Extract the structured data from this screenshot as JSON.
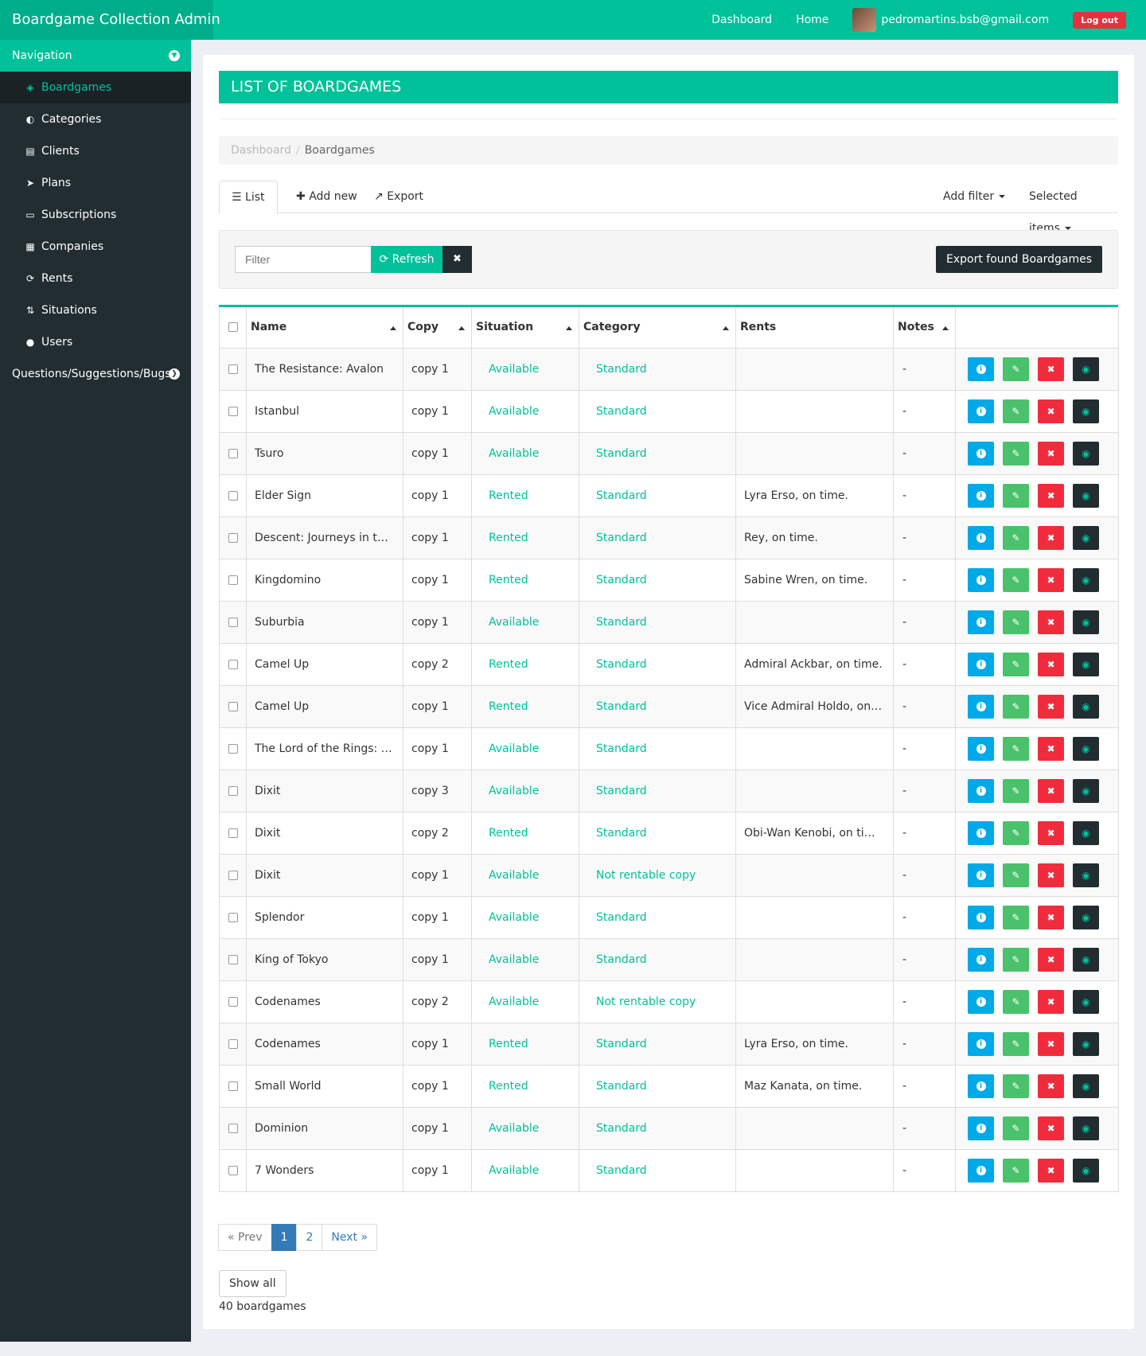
{
  "app": {
    "brand": "Boardgame Collection Admin",
    "nav_links": [
      "Dashboard",
      "Home"
    ],
    "user_email": "pedromartins.bsb@gmail.com",
    "logout_label": "Log out",
    "accent": "#00c19a"
  },
  "sidebar": {
    "header": "Navigation",
    "items": [
      {
        "label": "Boardgames",
        "icon": "cubes-icon",
        "active": true
      },
      {
        "label": "Categories",
        "icon": "adjust-icon"
      },
      {
        "label": "Clients",
        "icon": "id-card-icon"
      },
      {
        "label": "Plans",
        "icon": "tags-icon"
      },
      {
        "label": "Subscriptions",
        "icon": "credit-card-icon"
      },
      {
        "label": "Companies",
        "icon": "building-icon"
      },
      {
        "label": "Rents",
        "icon": "refresh-icon"
      },
      {
        "label": "Situations",
        "icon": "sort-numeric-icon"
      },
      {
        "label": "Users",
        "icon": "user-icon"
      }
    ],
    "extra": "Questions/Suggestions/Bugs?"
  },
  "main": {
    "title": "LIST OF BOARDGAMES",
    "breadcrumb": {
      "root": "Dashboard",
      "current": "Boardgames"
    },
    "tabs": {
      "list": "List",
      "add": "Add new",
      "export": "Export",
      "add_filter": "Add filter",
      "selected_items": "Selected items"
    },
    "filter": {
      "placeholder": "Filter",
      "refresh": "Refresh",
      "export_found": "Export found Boardgames"
    },
    "columns": [
      "Name",
      "Copy",
      "Situation",
      "Category",
      "Rents",
      "Notes"
    ],
    "rows": [
      {
        "name": "The Resistance: Avalon",
        "copy": "copy 1",
        "situation": "Available",
        "category": "Standard",
        "rents": "",
        "notes": "-"
      },
      {
        "name": "Istanbul",
        "copy": "copy 1",
        "situation": "Available",
        "category": "Standard",
        "rents": "",
        "notes": "-"
      },
      {
        "name": "Tsuro",
        "copy": "copy 1",
        "situation": "Available",
        "category": "Standard",
        "rents": "",
        "notes": "-"
      },
      {
        "name": "Elder Sign",
        "copy": "copy 1",
        "situation": "Rented",
        "category": "Standard",
        "rents": "Lyra Erso, on time.",
        "notes": "-"
      },
      {
        "name": "Descent: Journeys in the ...",
        "copy": "copy 1",
        "situation": "Rented",
        "category": "Standard",
        "rents": "Rey, on time.",
        "notes": "-"
      },
      {
        "name": "Kingdomino",
        "copy": "copy 1",
        "situation": "Rented",
        "category": "Standard",
        "rents": "Sabine Wren, on time.",
        "notes": "-"
      },
      {
        "name": "Suburbia",
        "copy": "copy 1",
        "situation": "Available",
        "category": "Standard",
        "rents": "",
        "notes": "-"
      },
      {
        "name": "Camel Up",
        "copy": "copy 2",
        "situation": "Rented",
        "category": "Standard",
        "rents": "Admiral Ackbar, on time.",
        "notes": "-"
      },
      {
        "name": "Camel Up",
        "copy": "copy 1",
        "situation": "Rented",
        "category": "Standard",
        "rents": "Vice Admiral Holdo, on ti...",
        "notes": "-"
      },
      {
        "name": "The Lord of the Rings: Th...",
        "copy": "copy 1",
        "situation": "Available",
        "category": "Standard",
        "rents": "",
        "notes": "-"
      },
      {
        "name": "Dixit",
        "copy": "copy 3",
        "situation": "Available",
        "category": "Standard",
        "rents": "",
        "notes": "-"
      },
      {
        "name": "Dixit",
        "copy": "copy 2",
        "situation": "Rented",
        "category": "Standard",
        "rents": "Obi-Wan Kenobi, on time.",
        "notes": "-"
      },
      {
        "name": "Dixit",
        "copy": "copy 1",
        "situation": "Available",
        "category": "Not rentable copy",
        "rents": "",
        "notes": "-"
      },
      {
        "name": "Splendor",
        "copy": "copy 1",
        "situation": "Available",
        "category": "Standard",
        "rents": "",
        "notes": "-"
      },
      {
        "name": "King of Tokyo",
        "copy": "copy 1",
        "situation": "Available",
        "category": "Standard",
        "rents": "",
        "notes": "-"
      },
      {
        "name": "Codenames",
        "copy": "copy 2",
        "situation": "Available",
        "category": "Not rentable copy",
        "rents": "",
        "notes": "-"
      },
      {
        "name": "Codenames",
        "copy": "copy 1",
        "situation": "Rented",
        "category": "Standard",
        "rents": "Lyra Erso, on time.",
        "notes": "-"
      },
      {
        "name": "Small World",
        "copy": "copy 1",
        "situation": "Rented",
        "category": "Standard",
        "rents": "Maz Kanata, on time.",
        "notes": "-"
      },
      {
        "name": "Dominion",
        "copy": "copy 1",
        "situation": "Available",
        "category": "Standard",
        "rents": "",
        "notes": "-"
      },
      {
        "name": "7 Wonders",
        "copy": "copy 1",
        "situation": "Available",
        "category": "Standard",
        "rents": "",
        "notes": "-"
      }
    ],
    "pagination": {
      "prev": "« Prev",
      "pages": [
        "1",
        "2"
      ],
      "current": "1",
      "next": "Next »"
    },
    "show_all": "Show all",
    "count": "40 boardgames"
  }
}
